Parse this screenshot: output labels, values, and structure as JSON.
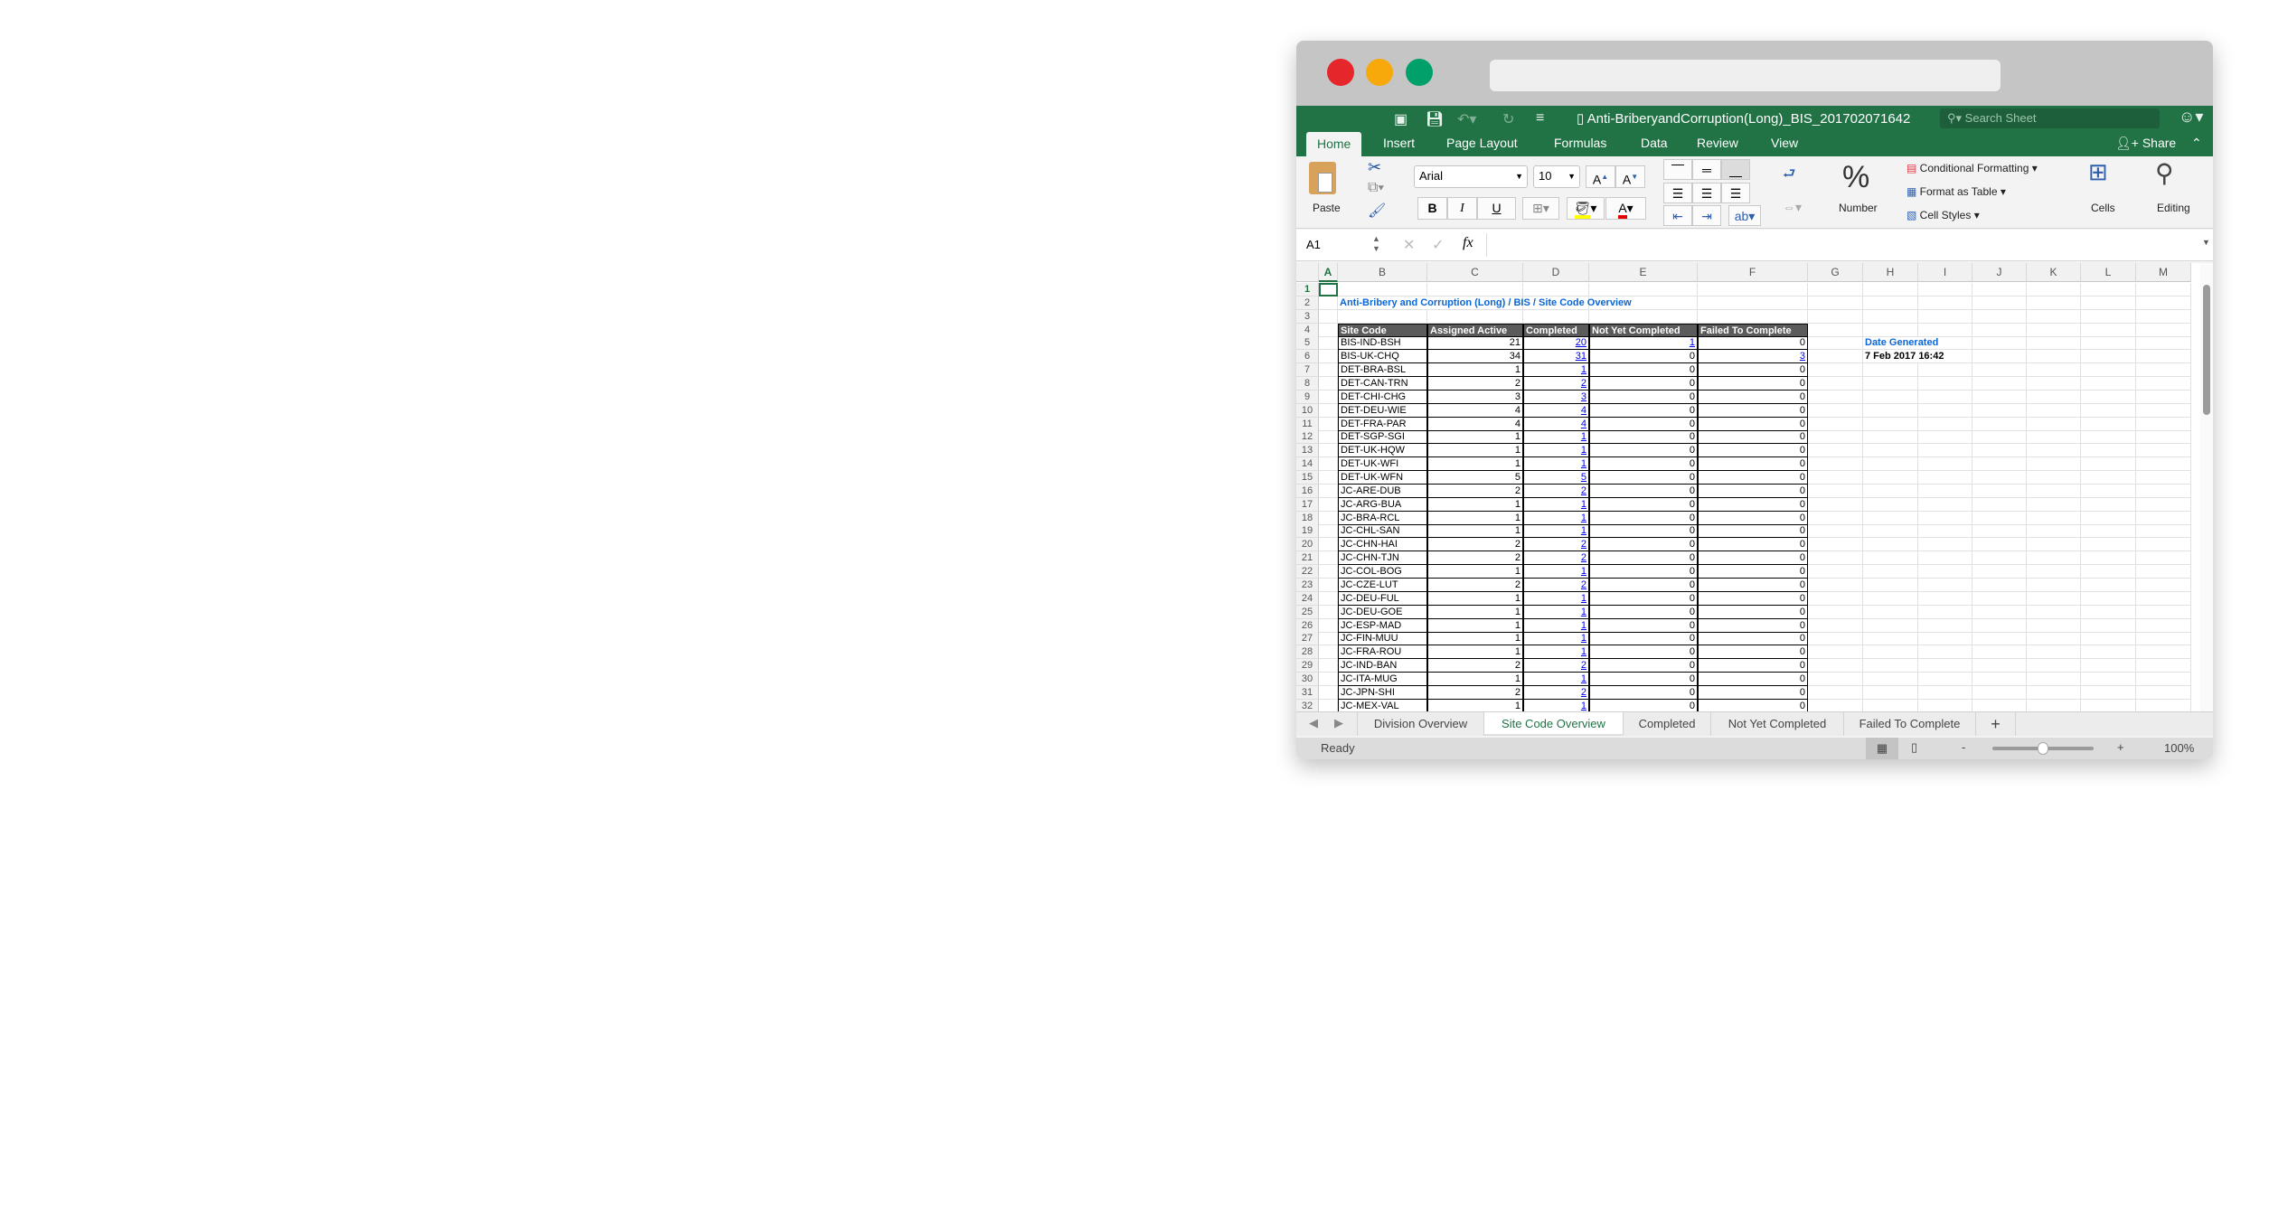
{
  "window": {
    "traffic_lights": {
      "close": "#e5262a",
      "minimize": "#f7a80b",
      "zoom": "#00a06a"
    }
  },
  "app": {
    "document_title": "Anti-BriberyandCorruption(Long)_BIS_201702071642",
    "search_placeholder": "Search Sheet",
    "accent_color": "#217346",
    "tabs": [
      "Home",
      "Insert",
      "Page Layout",
      "Formulas",
      "Data",
      "Review",
      "View"
    ],
    "active_tab": "Home",
    "share_label": "Share"
  },
  "ribbon": {
    "paste_label": "Paste",
    "font_name": "Arial",
    "font_size": "10",
    "bold": "B",
    "italic": "I",
    "underline": "U",
    "number_label": "Number",
    "number_symbol": "%",
    "conditional_formatting": "Conditional Formatting",
    "format_as_table": "Format as Table",
    "cell_styles": "Cell Styles",
    "cells_label": "Cells",
    "editing_label": "Editing"
  },
  "formula_bar": {
    "name_box": "A1",
    "fx": "fx",
    "formula": ""
  },
  "sheet": {
    "columns": [
      "A",
      "B",
      "C",
      "D",
      "E",
      "F",
      "G",
      "H",
      "I",
      "J",
      "K",
      "L",
      "M"
    ],
    "row_numbers": [
      1,
      2,
      3,
      4,
      5,
      6,
      7,
      8,
      9,
      10,
      11,
      12,
      13,
      14,
      15,
      16,
      17,
      18,
      19,
      20,
      21,
      22,
      23,
      24,
      25,
      26,
      27,
      28,
      29,
      30,
      31,
      32
    ],
    "selected_cell": "A1",
    "title": "Anti-Bribery and Corruption (Long) / BIS / Site Code Overview",
    "date_label": "Date Generated",
    "date_value": "7 Feb 2017 16:42",
    "headers": [
      "Site Code",
      "Assigned Active",
      "Completed",
      "Not Yet Completed",
      "Failed To Complete"
    ],
    "rows": [
      [
        "BIS-IND-BSH",
        21,
        20,
        1,
        0
      ],
      [
        "BIS-UK-CHQ",
        34,
        31,
        0,
        3
      ],
      [
        "DET-BRA-BSL",
        1,
        1,
        0,
        0
      ],
      [
        "DET-CAN-TRN",
        2,
        2,
        0,
        0
      ],
      [
        "DET-CHI-CHG",
        3,
        3,
        0,
        0
      ],
      [
        "DET-DEU-WIE",
        4,
        4,
        0,
        0
      ],
      [
        "DET-FRA-PAR",
        4,
        4,
        0,
        0
      ],
      [
        "DET-SGP-SGI",
        1,
        1,
        0,
        0
      ],
      [
        "DET-UK-HQW",
        1,
        1,
        0,
        0
      ],
      [
        "DET-UK-WFI",
        1,
        1,
        0,
        0
      ],
      [
        "DET-UK-WFN",
        5,
        5,
        0,
        0
      ],
      [
        "JC-ARE-DUB",
        2,
        2,
        0,
        0
      ],
      [
        "JC-ARG-BUA",
        1,
        1,
        0,
        0
      ],
      [
        "JC-BRA-RCL",
        1,
        1,
        0,
        0
      ],
      [
        "JC-CHL-SAN",
        1,
        1,
        0,
        0
      ],
      [
        "JC-CHN-HAI",
        2,
        2,
        0,
        0
      ],
      [
        "JC-CHN-TJN",
        2,
        2,
        0,
        0
      ],
      [
        "JC-COL-BOG",
        1,
        1,
        0,
        0
      ],
      [
        "JC-CZE-LUT",
        2,
        2,
        0,
        0
      ],
      [
        "JC-DEU-FUL",
        1,
        1,
        0,
        0
      ],
      [
        "JC-DEU-GOE",
        1,
        1,
        0,
        0
      ],
      [
        "JC-ESP-MAD",
        1,
        1,
        0,
        0
      ],
      [
        "JC-FIN-MUU",
        1,
        1,
        0,
        0
      ],
      [
        "JC-FRA-ROU",
        1,
        1,
        0,
        0
      ],
      [
        "JC-IND-BAN",
        2,
        2,
        0,
        0
      ],
      [
        "JC-ITA-MUG",
        1,
        1,
        0,
        0
      ],
      [
        "JC-JPN-SHI",
        2,
        2,
        0,
        0
      ],
      [
        "JC-MEX-VAL",
        1,
        1,
        0,
        0
      ]
    ]
  },
  "sheet_tabs": [
    "Division Overview",
    "Site Code Overview",
    "Completed",
    "Not Yet Completed",
    "Failed To Complete"
  ],
  "active_sheet_tab": "Site Code Overview",
  "add_sheet": "+",
  "status": {
    "text": "Ready",
    "zoom": "100%",
    "zoom_percent": 100,
    "minus": "-",
    "plus": "+"
  }
}
